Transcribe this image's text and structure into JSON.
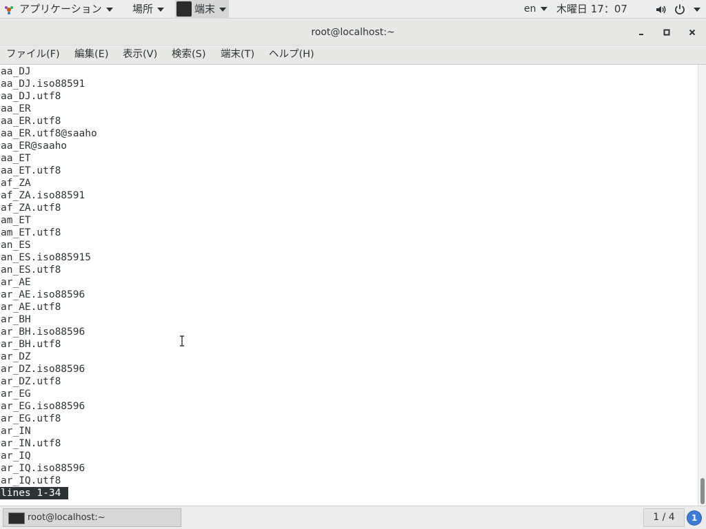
{
  "topbar": {
    "applications_label": "アプリケーション",
    "places_label": "場所",
    "terminal_task_label": "端末",
    "language": "en",
    "clock": "木曜日 17：07"
  },
  "window": {
    "title": "root@localhost:~"
  },
  "menu": {
    "items": [
      "ファイル(F)",
      "編集(E)",
      "表示(V)",
      "検索(S)",
      "端末(T)",
      "ヘルプ(H)"
    ]
  },
  "terminal": {
    "lines": [
      "aa_DJ",
      "aa_DJ.iso88591",
      "aa_DJ.utf8",
      "aa_ER",
      "aa_ER.utf8",
      "aa_ER.utf8@saaho",
      "aa_ER@saaho",
      "aa_ET",
      "aa_ET.utf8",
      "af_ZA",
      "af_ZA.iso88591",
      "af_ZA.utf8",
      "am_ET",
      "am_ET.utf8",
      "an_ES",
      "an_ES.iso885915",
      "an_ES.utf8",
      "ar_AE",
      "ar_AE.iso88596",
      "ar_AE.utf8",
      "ar_BH",
      "ar_BH.iso88596",
      "ar_BH.utf8",
      "ar_DZ",
      "ar_DZ.iso88596",
      "ar_DZ.utf8",
      "ar_EG",
      "ar_EG.iso88596",
      "ar_EG.utf8",
      "ar_IN",
      "ar_IN.utf8",
      "ar_IQ",
      "ar_IQ.iso88596",
      "ar_IQ.utf8"
    ],
    "status": "lines 1-34"
  },
  "taskbar": {
    "window_label": "root@localhost:~",
    "workspace": "1 / 4",
    "notification_count": "1"
  },
  "colors": {
    "terminal_bg": "#ffffff",
    "terminal_fg": "#2e3436",
    "status_bg": "#2e3436",
    "notification": "#3d7bd4"
  }
}
